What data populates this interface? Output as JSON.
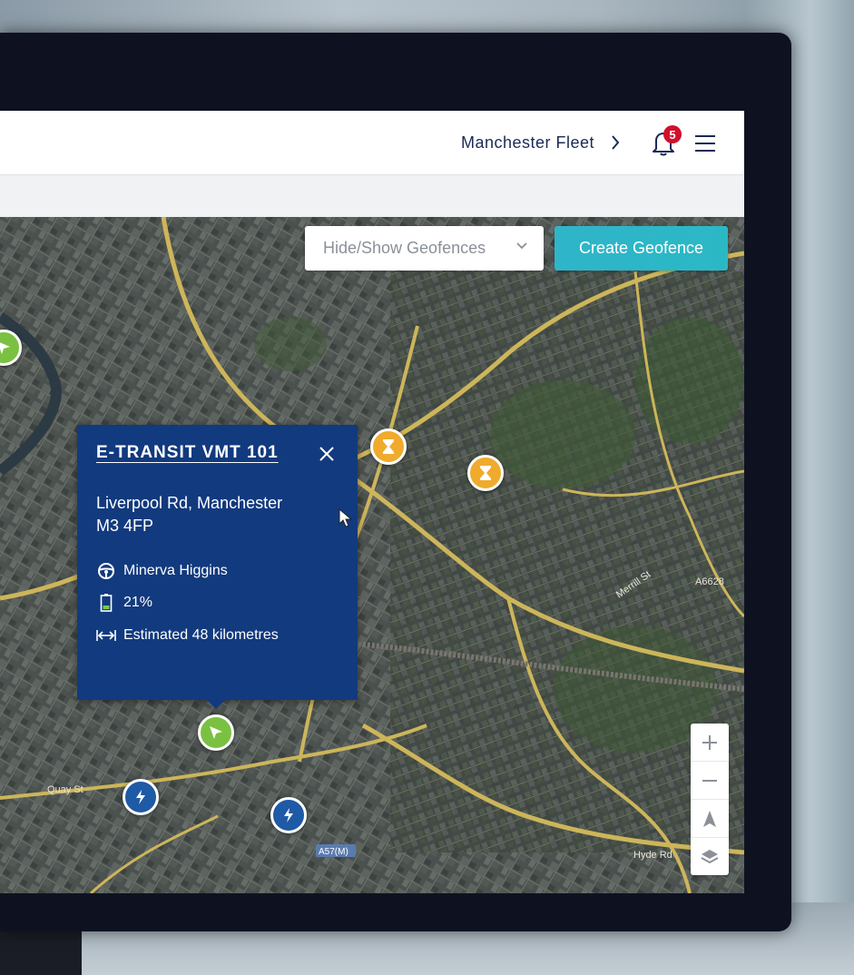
{
  "header": {
    "fleet_label": "Manchester Fleet",
    "notification_count": "5"
  },
  "map_controls": {
    "geofence_select_label": "Hide/Show Geofences",
    "create_geofence_label": "Create Geofence"
  },
  "popup": {
    "vehicle_name": "E-TRANSIT VMT 101",
    "address_line1": "Liverpool Rd, Manchester",
    "address_line2": "M3 4FP",
    "driver": "Minerva Higgins",
    "battery": "21%",
    "range": "Estimated 48 kilometres"
  },
  "map_labels": {
    "road_a6628": "A6628",
    "road_a57m": "A57(M)",
    "road_hyde": "Hyde Rd",
    "road_quay": "Quay St",
    "road_merrill": "Merrill St"
  },
  "colors": {
    "popup_bg": "#123a7e",
    "accent": "#2fb5c9",
    "badge": "#d0102c",
    "marker_orange": "#f0ab2c",
    "marker_green": "#7ac142",
    "marker_blue": "#1f5aa6"
  }
}
